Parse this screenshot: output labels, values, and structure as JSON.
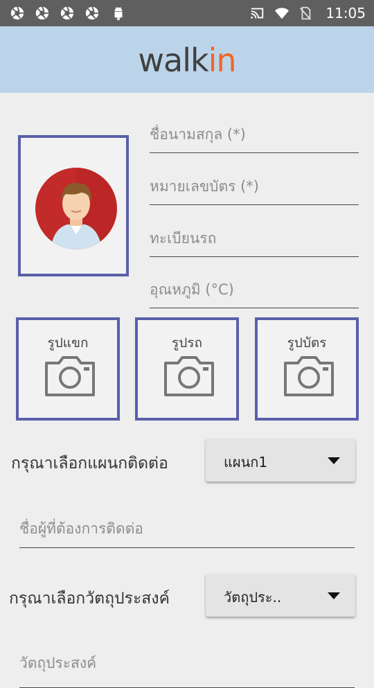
{
  "status_bar": {
    "time": "11:05",
    "left_icons": [
      "aperture-icon",
      "aperture-icon",
      "aperture-icon",
      "aperture-icon",
      "android-icon"
    ],
    "right_icons": [
      "cast-icon",
      "wifi-icon",
      "no-sim-icon"
    ]
  },
  "header": {
    "logo_part1": "walk",
    "logo_part2": "in",
    "accent_color": "#f26522",
    "bg_color": "#bcd4ea"
  },
  "form": {
    "name_placeholder": "ชื่อนามสกุล (*)",
    "id_placeholder": "หมายเลขบัตร (*)",
    "plate_placeholder": "ทะเบียนรถ",
    "temp_placeholder": "อุณหภูมิ (°C)",
    "photo_guest": "รูปแขก",
    "photo_car": "รูปรถ",
    "photo_card": "รูปบัตร",
    "dept_label": "กรุณาเลือกแผนกติดต่อ",
    "dept_value": "แผนก1",
    "contact_placeholder": "ชื่อผู้ที่ต้องการติดต่อ",
    "purpose_label": "กรุณาเลือกวัตถุประสงค์",
    "purpose_value": "วัตถุประ..",
    "purpose_field_placeholder": "วัตถุประสงค์"
  },
  "colors": {
    "frame": "#5a5faa",
    "avatar_bg": "#c32a2a"
  }
}
